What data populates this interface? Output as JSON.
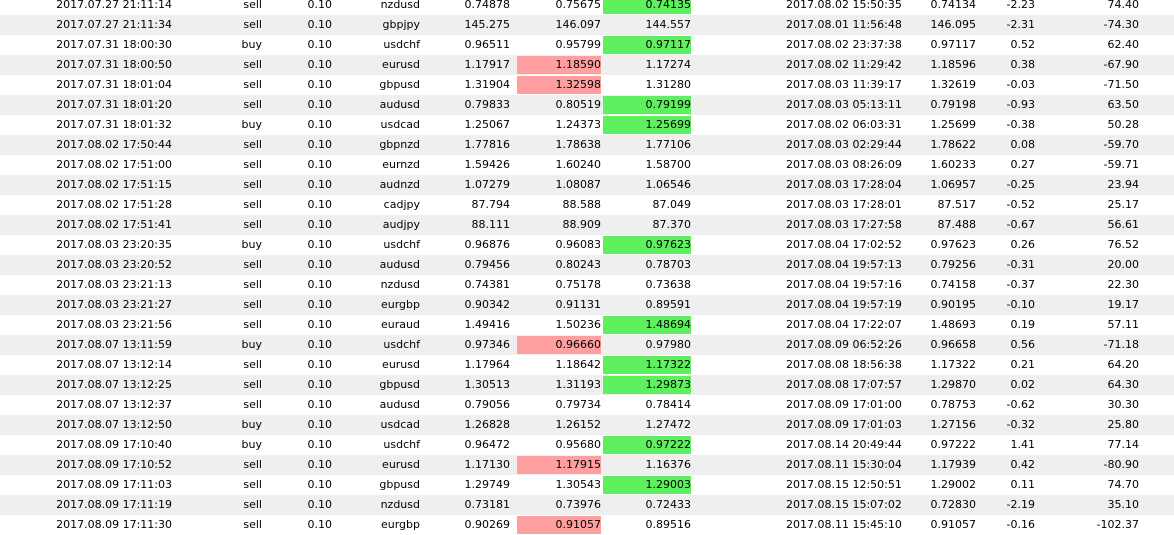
{
  "colors": {
    "red_highlight": "#ff9f9f",
    "green_highlight": "#5ef05e",
    "row_alt": "#efefef"
  },
  "rows": [
    {
      "open": "2017.07.27 21:11:14",
      "type": "sell",
      "size": "0.10",
      "symbol": "nzdusd",
      "price": "0.74878",
      "sl": "0.75675",
      "tp": "0.74135",
      "close": "2017.08.02 15:50:35",
      "close_price": "0.74134",
      "swap": "-2.23",
      "profit": "74.40",
      "hit": "tp"
    },
    {
      "open": "2017.07.27 21:11:34",
      "type": "sell",
      "size": "0.10",
      "symbol": "gbpjpy",
      "price": "145.275",
      "sl": "146.097",
      "tp": "144.557",
      "close": "2017.08.01 11:56:48",
      "close_price": "146.095",
      "swap": "-2.31",
      "profit": "-74.30",
      "hit": ""
    },
    {
      "open": "2017.07.31 18:00:30",
      "type": "buy",
      "size": "0.10",
      "symbol": "usdchf",
      "price": "0.96511",
      "sl": "0.95799",
      "tp": "0.97117",
      "close": "2017.08.02 23:37:38",
      "close_price": "0.97117",
      "swap": "0.52",
      "profit": "62.40",
      "hit": "tp"
    },
    {
      "open": "2017.07.31 18:00:50",
      "type": "sell",
      "size": "0.10",
      "symbol": "eurusd",
      "price": "1.17917",
      "sl": "1.18590",
      "tp": "1.17274",
      "close": "2017.08.02 11:29:42",
      "close_price": "1.18596",
      "swap": "0.38",
      "profit": "-67.90",
      "hit": "sl"
    },
    {
      "open": "2017.07.31 18:01:04",
      "type": "sell",
      "size": "0.10",
      "symbol": "gbpusd",
      "price": "1.31904",
      "sl": "1.32598",
      "tp": "1.31280",
      "close": "2017.08.03 11:39:17",
      "close_price": "1.32619",
      "swap": "-0.03",
      "profit": "-71.50",
      "hit": "sl"
    },
    {
      "open": "2017.07.31 18:01:20",
      "type": "sell",
      "size": "0.10",
      "symbol": "audusd",
      "price": "0.79833",
      "sl": "0.80519",
      "tp": "0.79199",
      "close": "2017.08.03 05:13:11",
      "close_price": "0.79198",
      "swap": "-0.93",
      "profit": "63.50",
      "hit": "tp"
    },
    {
      "open": "2017.07.31 18:01:32",
      "type": "buy",
      "size": "0.10",
      "symbol": "usdcad",
      "price": "1.25067",
      "sl": "1.24373",
      "tp": "1.25699",
      "close": "2017.08.02 06:03:31",
      "close_price": "1.25699",
      "swap": "-0.38",
      "profit": "50.28",
      "hit": "tp"
    },
    {
      "open": "2017.08.02 17:50:44",
      "type": "sell",
      "size": "0.10",
      "symbol": "gbpnzd",
      "price": "1.77816",
      "sl": "1.78638",
      "tp": "1.77106",
      "close": "2017.08.03 02:29:44",
      "close_price": "1.78622",
      "swap": "0.08",
      "profit": "-59.70",
      "hit": ""
    },
    {
      "open": "2017.08.02 17:51:00",
      "type": "sell",
      "size": "0.10",
      "symbol": "eurnzd",
      "price": "1.59426",
      "sl": "1.60240",
      "tp": "1.58700",
      "close": "2017.08.03 08:26:09",
      "close_price": "1.60233",
      "swap": "0.27",
      "profit": "-59.71",
      "hit": ""
    },
    {
      "open": "2017.08.02 17:51:15",
      "type": "sell",
      "size": "0.10",
      "symbol": "audnzd",
      "price": "1.07279",
      "sl": "1.08087",
      "tp": "1.06546",
      "close": "2017.08.03 17:28:04",
      "close_price": "1.06957",
      "swap": "-0.25",
      "profit": "23.94",
      "hit": ""
    },
    {
      "open": "2017.08.02 17:51:28",
      "type": "sell",
      "size": "0.10",
      "symbol": "cadjpy",
      "price": "87.794",
      "sl": "88.588",
      "tp": "87.049",
      "close": "2017.08.03 17:28:01",
      "close_price": "87.517",
      "swap": "-0.52",
      "profit": "25.17",
      "hit": ""
    },
    {
      "open": "2017.08.02 17:51:41",
      "type": "sell",
      "size": "0.10",
      "symbol": "audjpy",
      "price": "88.111",
      "sl": "88.909",
      "tp": "87.370",
      "close": "2017.08.03 17:27:58",
      "close_price": "87.488",
      "swap": "-0.67",
      "profit": "56.61",
      "hit": ""
    },
    {
      "open": "2017.08.03 23:20:35",
      "type": "buy",
      "size": "0.10",
      "symbol": "usdchf",
      "price": "0.96876",
      "sl": "0.96083",
      "tp": "0.97623",
      "close": "2017.08.04 17:02:52",
      "close_price": "0.97623",
      "swap": "0.26",
      "profit": "76.52",
      "hit": "tp"
    },
    {
      "open": "2017.08.03 23:20:52",
      "type": "sell",
      "size": "0.10",
      "symbol": "audusd",
      "price": "0.79456",
      "sl": "0.80243",
      "tp": "0.78703",
      "close": "2017.08.04 19:57:13",
      "close_price": "0.79256",
      "swap": "-0.31",
      "profit": "20.00",
      "hit": ""
    },
    {
      "open": "2017.08.03 23:21:13",
      "type": "sell",
      "size": "0.10",
      "symbol": "nzdusd",
      "price": "0.74381",
      "sl": "0.75178",
      "tp": "0.73638",
      "close": "2017.08.04 19:57:16",
      "close_price": "0.74158",
      "swap": "-0.37",
      "profit": "22.30",
      "hit": ""
    },
    {
      "open": "2017.08.03 23:21:27",
      "type": "sell",
      "size": "0.10",
      "symbol": "eurgbp",
      "price": "0.90342",
      "sl": "0.91131",
      "tp": "0.89591",
      "close": "2017.08.04 19:57:19",
      "close_price": "0.90195",
      "swap": "-0.10",
      "profit": "19.17",
      "hit": ""
    },
    {
      "open": "2017.08.03 23:21:56",
      "type": "sell",
      "size": "0.10",
      "symbol": "euraud",
      "price": "1.49416",
      "sl": "1.50236",
      "tp": "1.48694",
      "close": "2017.08.04 17:22:07",
      "close_price": "1.48693",
      "swap": "0.19",
      "profit": "57.11",
      "hit": "tp"
    },
    {
      "open": "2017.08.07 13:11:59",
      "type": "buy",
      "size": "0.10",
      "symbol": "usdchf",
      "price": "0.97346",
      "sl": "0.96660",
      "tp": "0.97980",
      "close": "2017.08.09 06:52:26",
      "close_price": "0.96658",
      "swap": "0.56",
      "profit": "-71.18",
      "hit": "sl"
    },
    {
      "open": "2017.08.07 13:12:14",
      "type": "sell",
      "size": "0.10",
      "symbol": "eurusd",
      "price": "1.17964",
      "sl": "1.18642",
      "tp": "1.17322",
      "close": "2017.08.08 18:56:38",
      "close_price": "1.17322",
      "swap": "0.21",
      "profit": "64.20",
      "hit": "tp"
    },
    {
      "open": "2017.08.07 13:12:25",
      "type": "sell",
      "size": "0.10",
      "symbol": "gbpusd",
      "price": "1.30513",
      "sl": "1.31193",
      "tp": "1.29873",
      "close": "2017.08.08 17:07:57",
      "close_price": "1.29870",
      "swap": "0.02",
      "profit": "64.30",
      "hit": "tp"
    },
    {
      "open": "2017.08.07 13:12:37",
      "type": "sell",
      "size": "0.10",
      "symbol": "audusd",
      "price": "0.79056",
      "sl": "0.79734",
      "tp": "0.78414",
      "close": "2017.08.09 17:01:00",
      "close_price": "0.78753",
      "swap": "-0.62",
      "profit": "30.30",
      "hit": ""
    },
    {
      "open": "2017.08.07 13:12:50",
      "type": "buy",
      "size": "0.10",
      "symbol": "usdcad",
      "price": "1.26828",
      "sl": "1.26152",
      "tp": "1.27472",
      "close": "2017.08.09 17:01:03",
      "close_price": "1.27156",
      "swap": "-0.32",
      "profit": "25.80",
      "hit": ""
    },
    {
      "open": "2017.08.09 17:10:40",
      "type": "buy",
      "size": "0.10",
      "symbol": "usdchf",
      "price": "0.96472",
      "sl": "0.95680",
      "tp": "0.97222",
      "close": "2017.08.14 20:49:44",
      "close_price": "0.97222",
      "swap": "1.41",
      "profit": "77.14",
      "hit": "tp"
    },
    {
      "open": "2017.08.09 17:10:52",
      "type": "sell",
      "size": "0.10",
      "symbol": "eurusd",
      "price": "1.17130",
      "sl": "1.17915",
      "tp": "1.16376",
      "close": "2017.08.11 15:30:04",
      "close_price": "1.17939",
      "swap": "0.42",
      "profit": "-80.90",
      "hit": "sl"
    },
    {
      "open": "2017.08.09 17:11:03",
      "type": "sell",
      "size": "0.10",
      "symbol": "gbpusd",
      "price": "1.29749",
      "sl": "1.30543",
      "tp": "1.29003",
      "close": "2017.08.15 12:50:51",
      "close_price": "1.29002",
      "swap": "0.11",
      "profit": "74.70",
      "hit": "tp"
    },
    {
      "open": "2017.08.09 17:11:19",
      "type": "sell",
      "size": "0.10",
      "symbol": "nzdusd",
      "price": "0.73181",
      "sl": "0.73976",
      "tp": "0.72433",
      "close": "2017.08.15 15:07:02",
      "close_price": "0.72830",
      "swap": "-2.19",
      "profit": "35.10",
      "hit": ""
    },
    {
      "open": "2017.08.09 17:11:30",
      "type": "sell",
      "size": "0.10",
      "symbol": "eurgbp",
      "price": "0.90269",
      "sl": "0.91057",
      "tp": "0.89516",
      "close": "2017.08.11 15:45:10",
      "close_price": "0.91057",
      "swap": "-0.16",
      "profit": "-102.37",
      "hit": "sl"
    }
  ]
}
